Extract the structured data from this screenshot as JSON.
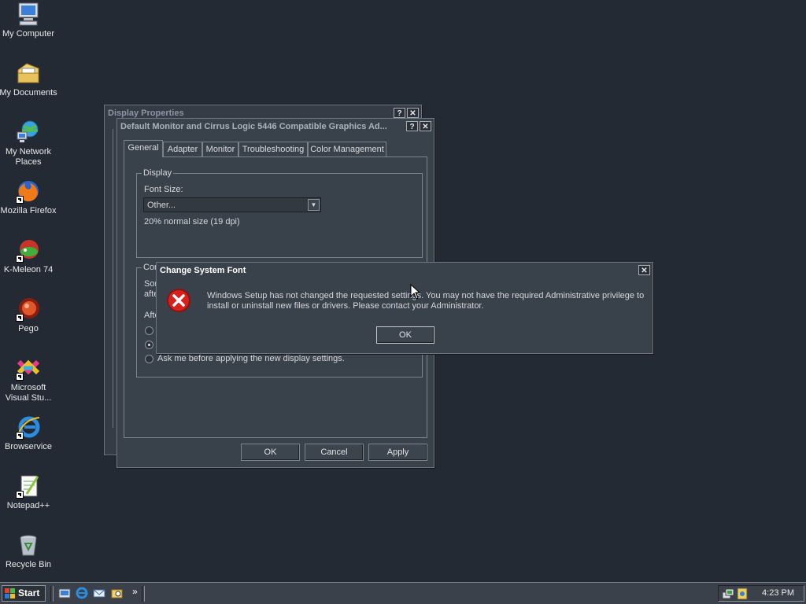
{
  "desktop": {
    "icons": [
      {
        "label": "My Computer",
        "icon": "computer-icon"
      },
      {
        "label": "My Documents",
        "icon": "folder-icon"
      },
      {
        "label": "My Network Places",
        "icon": "network-icon"
      },
      {
        "label": "Mozilla Firefox",
        "icon": "firefox-icon"
      },
      {
        "label": "K-Meleon 74",
        "icon": "kmeleon-icon"
      },
      {
        "label": "Pego",
        "icon": "pego-icon"
      },
      {
        "label": "Microsoft Visual Stu...",
        "icon": "visual-studio-icon"
      },
      {
        "label": "Browservice",
        "icon": "ie-icon"
      },
      {
        "label": "Notepad++",
        "icon": "notepad-icon"
      },
      {
        "label": "Recycle Bin",
        "icon": "recycle-bin-icon"
      }
    ]
  },
  "display_properties": {
    "title": "Display Properties"
  },
  "monitor_dialog": {
    "title": "Default Monitor and Cirrus Logic 5446 Compatible Graphics Ad...",
    "tabs": [
      "General",
      "Adapter",
      "Monitor",
      "Troubleshooting",
      "Color Management"
    ],
    "display_group": "Display",
    "font_size_label": "Font Size:",
    "font_size_value": "Other...",
    "font_size_note": "20% normal size (19 dpi)",
    "compat_group": "Cor",
    "compat_line1": "Sor",
    "compat_line2": "afte",
    "after_label": "Afte",
    "radio_ask": "Ask me before applying the new display settings.",
    "ok": "OK",
    "cancel": "Cancel",
    "apply": "Apply"
  },
  "error_dialog": {
    "title": "Change System Font",
    "message_line1": "Windows Setup has not changed the requested settings.  You may not have the required Administrative privilege to",
    "message_line2": "install or uninstall new files or drivers.  Please contact your Administrator.",
    "ok": "OK"
  },
  "taskbar": {
    "start_label": "Start",
    "overflow": "»",
    "clock": "4:23 PM"
  },
  "colors": {
    "desktop": "#242a33",
    "window": "#39414b",
    "error_red": "#d9201c"
  }
}
